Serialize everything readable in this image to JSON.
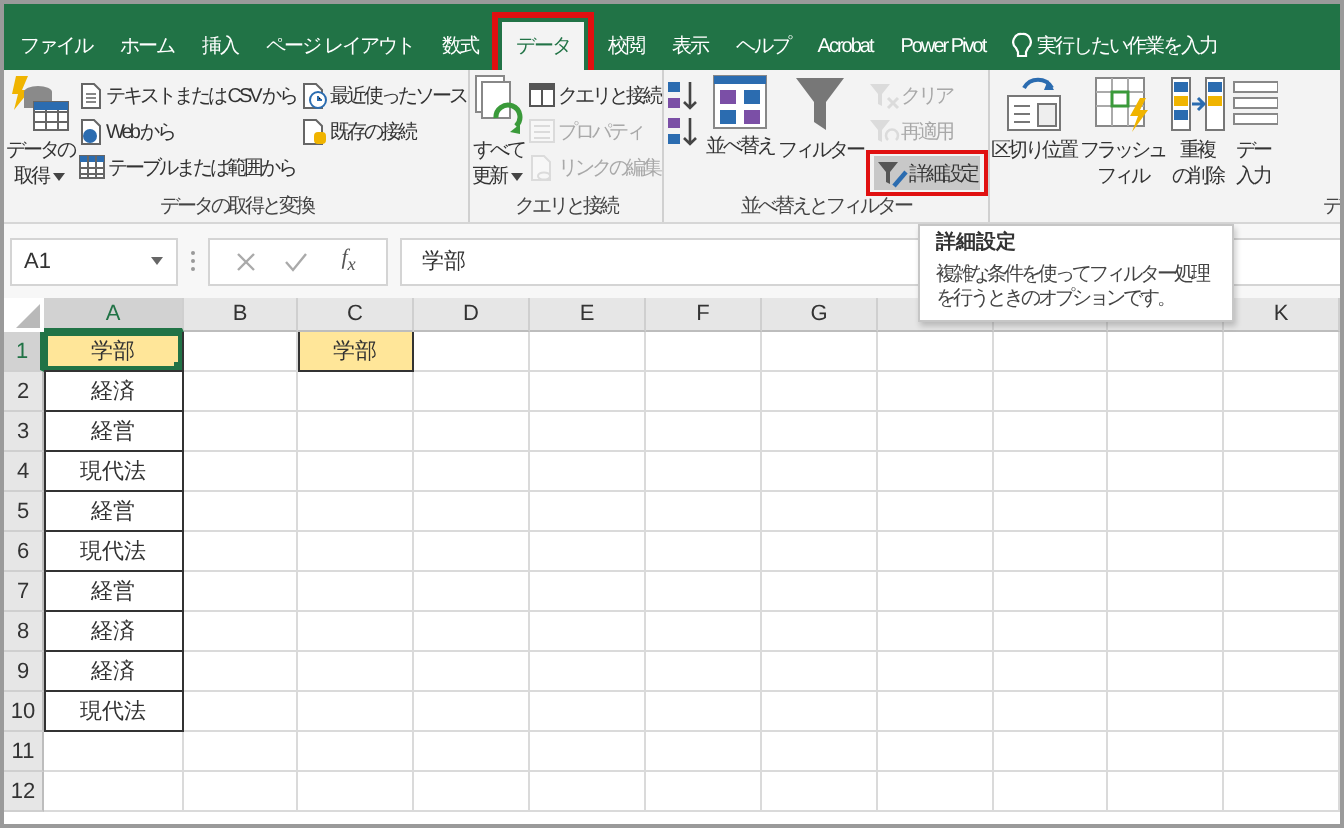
{
  "tabs": [
    {
      "label": "ファイル",
      "selected": false
    },
    {
      "label": "ホーム",
      "selected": false
    },
    {
      "label": "挿入",
      "selected": false
    },
    {
      "label": "ページ レイアウト",
      "selected": false
    },
    {
      "label": "数式",
      "selected": false
    },
    {
      "label": "データ",
      "selected": true,
      "annotated": true
    },
    {
      "label": "校閲",
      "selected": false
    },
    {
      "label": "表示",
      "selected": false
    },
    {
      "label": "ヘルプ",
      "selected": false
    },
    {
      "label": "Acrobat",
      "selected": false
    },
    {
      "label": "Power Pivot",
      "selected": false
    }
  ],
  "tell_me": {
    "text": "実行したい作業を入力"
  },
  "ribbon_groups": [
    {
      "label": "データの取得と変換",
      "columns": [
        {
          "kind": "large",
          "lines": [
            "データの",
            "取得"
          ],
          "dropdown": true
        },
        {
          "kind": "stack",
          "items": [
            {
              "label": "テキストまたは CSV から",
              "disabled": false
            },
            {
              "label": "Web から",
              "disabled": false
            },
            {
              "label": "テーブルまたは範囲から",
              "disabled": false
            }
          ]
        },
        {
          "kind": "stack",
          "items": [
            {
              "label": "最近使ったソース",
              "disabled": false
            },
            {
              "label": "既存の接続",
              "disabled": false
            }
          ]
        }
      ]
    },
    {
      "label": "クエリと接続",
      "columns": [
        {
          "kind": "large",
          "lines": [
            "すべて",
            "更新"
          ],
          "dropdown": true
        },
        {
          "kind": "stack",
          "items": [
            {
              "label": "クエリと接続",
              "disabled": false
            },
            {
              "label": "プロパティ",
              "disabled": true
            },
            {
              "label": "リンクの編集",
              "disabled": true
            }
          ]
        }
      ]
    },
    {
      "label": "並べ替えとフィルター",
      "columns": [
        {
          "kind": "stack",
          "items": [
            {
              "disabled": false
            },
            {
              "disabled": false
            }
          ]
        },
        {
          "kind": "large",
          "lines": [
            "並べ替え"
          ]
        },
        {
          "kind": "large",
          "lines": [
            "フィルター"
          ]
        },
        {
          "kind": "stack",
          "items": [
            {
              "label": "クリア",
              "disabled": true
            },
            {
              "label": "再適用",
              "disabled": true
            },
            {
              "label": "詳細設定",
              "disabled": false,
              "hovered": true,
              "annotated": true
            }
          ]
        }
      ]
    },
    {
      "label": "デ",
      "columns": [
        {
          "kind": "large",
          "lines": [
            "区切り位置"
          ]
        },
        {
          "kind": "large",
          "lines": [
            "フラッシュ",
            "フィル"
          ]
        },
        {
          "kind": "large",
          "lines": [
            "重複",
            "の削除"
          ]
        },
        {
          "kind": "large",
          "lines": [
            "デー",
            "入力"
          ]
        }
      ]
    }
  ],
  "tooltip": {
    "title": "詳細設定",
    "text": "複雑な条件を使ってフィルター処理を行うときのオプションです。"
  },
  "formula_bar": {
    "name_box": "A1",
    "function_label": "f$_{x}$",
    "value": "学部"
  },
  "columns": [
    {
      "label": "A",
      "selected": true
    },
    {
      "label": "B",
      "selected": false
    },
    {
      "label": "C",
      "selected": false
    },
    {
      "label": "D",
      "selected": false
    },
    {
      "label": "E",
      "selected": false
    },
    {
      "label": "F",
      "selected": false
    },
    {
      "label": "G",
      "selected": false
    },
    {
      "selected": false
    },
    {
      "selected": false
    },
    {
      "selected": false
    },
    {
      "label": "K",
      "selected": false
    }
  ],
  "rows": [
    {
      "number": "1",
      "selected": true,
      "cells": [
        {
          "text": "学部",
          "highlighted": true,
          "active": true,
          "bordered": true
        },
        {},
        {
          "text": "学部",
          "highlighted": true,
          "active": false,
          "bordered": true
        }
      ]
    },
    {
      "number": "2",
      "selected": false,
      "cells": [
        {
          "text": "経済",
          "highlighted": false,
          "active": false,
          "bordered": true
        }
      ]
    },
    {
      "number": "3",
      "selected": false,
      "cells": [
        {
          "text": "経営",
          "highlighted": false,
          "active": false,
          "bordered": true
        }
      ]
    },
    {
      "number": "4",
      "selected": false,
      "cells": [
        {
          "text": "現代法",
          "highlighted": false,
          "active": false,
          "bordered": true
        }
      ]
    },
    {
      "number": "5",
      "selected": false,
      "cells": [
        {
          "text": "経営",
          "highlighted": false,
          "active": false,
          "bordered": true
        }
      ]
    },
    {
      "number": "6",
      "selected": false,
      "cells": [
        {
          "text": "現代法",
          "highlighted": false,
          "active": false,
          "bordered": true
        }
      ]
    },
    {
      "number": "7",
      "selected": false,
      "cells": [
        {
          "text": "経営",
          "highlighted": false,
          "active": false,
          "bordered": true
        }
      ]
    },
    {
      "number": "8",
      "selected": false,
      "cells": [
        {
          "text": "経済",
          "highlighted": false,
          "active": false,
          "bordered": true
        }
      ]
    },
    {
      "number": "9",
      "selected": false,
      "cells": [
        {
          "text": "経済",
          "highlighted": false,
          "active": false,
          "bordered": true
        }
      ]
    },
    {
      "number": "10",
      "selected": false,
      "cells": [
        {
          "text": "現代法",
          "highlighted": false,
          "active": false,
          "bordered": true
        }
      ]
    },
    {
      "number": "11",
      "selected": false
    },
    {
      "number": "12",
      "selected": false
    }
  ]
}
